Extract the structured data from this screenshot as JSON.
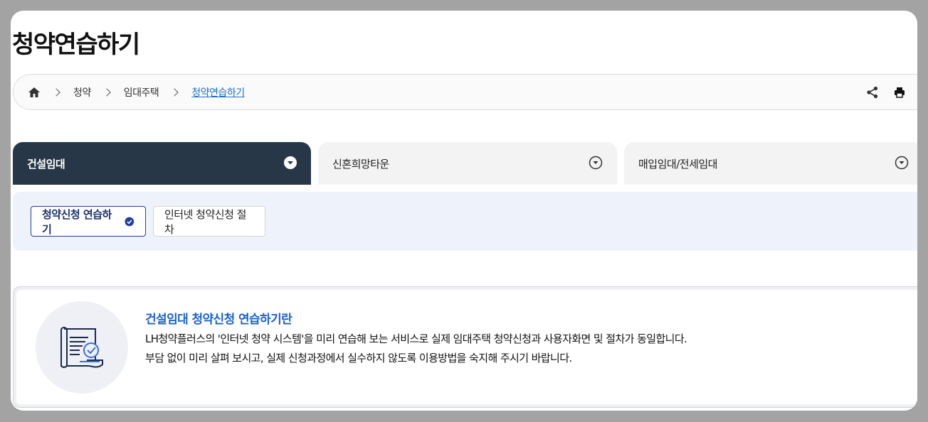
{
  "page": {
    "title": "청약연습하기"
  },
  "breadcrumb": {
    "home_icon": "home-icon",
    "items": [
      "청약",
      "임대주택"
    ],
    "current": "청약연습하기",
    "share_icon": "share-icon",
    "print_icon": "print-icon"
  },
  "tabs": [
    {
      "label": "건설임대",
      "active": true,
      "icon": "chevron-circle-down-icon"
    },
    {
      "label": "신혼희망타운",
      "active": false,
      "icon": "chevron-circle-down-icon"
    },
    {
      "label": "매입임대/전세임대",
      "active": false,
      "icon": "chevron-circle-down-icon"
    }
  ],
  "subtabs": [
    {
      "label": "청약신청 연습하기",
      "active": true,
      "icon": "check-circle-icon"
    },
    {
      "label": "인터넷 청약신청 절차",
      "active": false
    }
  ],
  "info": {
    "icon": "document-check-icon",
    "title": "건설임대 청약신청 연습하기란",
    "line1": "LH청약플러스의 '인터넷 청약 시스템'을 미리 연습해 보는 서비스로 실제 임대주택 청약신청과 사용자화면 및 절차가 동일합니다.",
    "line2": "부담 없이 미리 살펴 보시고, 실제 신청과정에서 실수하지 않도록 이용방법을 숙지해 주시기 바랍니다."
  },
  "colors": {
    "active_tab": "#273747",
    "accent_blue": "#1b63c5",
    "link_blue": "#1a6fc0",
    "subtab_bg": "#eef2fa"
  }
}
